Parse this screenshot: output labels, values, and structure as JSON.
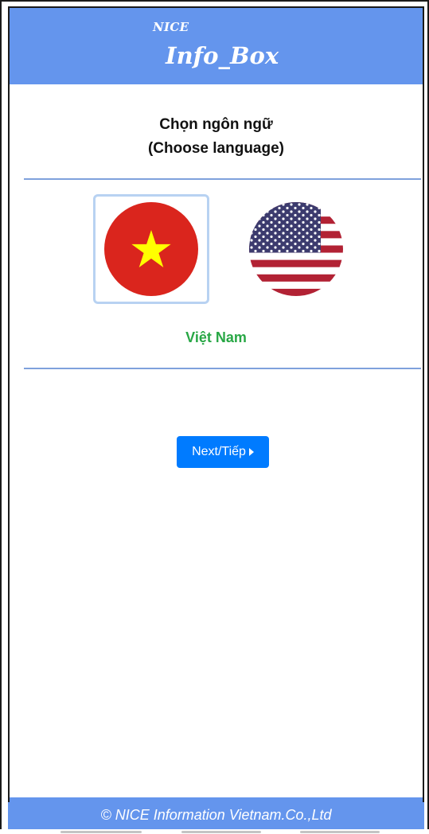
{
  "header": {
    "brand_small": "NICE",
    "brand_title": "Info_Box"
  },
  "prompt": {
    "line1": "Chọn ngôn ngữ",
    "line2": "(Choose language)"
  },
  "languages": [
    {
      "name": "vietnam-flag",
      "selected": true
    },
    {
      "name": "usa-flag",
      "selected": false
    }
  ],
  "selected_language_label": "Việt Nam",
  "next_button": {
    "label": "Next/Tiếp"
  },
  "footer": {
    "copyright": "© NICE Information Vietnam.Co.,Ltd"
  },
  "colors": {
    "header_bg": "#6495ed",
    "primary_button": "#007bff",
    "selected_text": "#28a745",
    "divider": "#7fa1dc",
    "vn_red": "#da251d",
    "vn_star": "#ffff00",
    "us_red": "#b22234",
    "us_blue": "#3c3b6e"
  }
}
